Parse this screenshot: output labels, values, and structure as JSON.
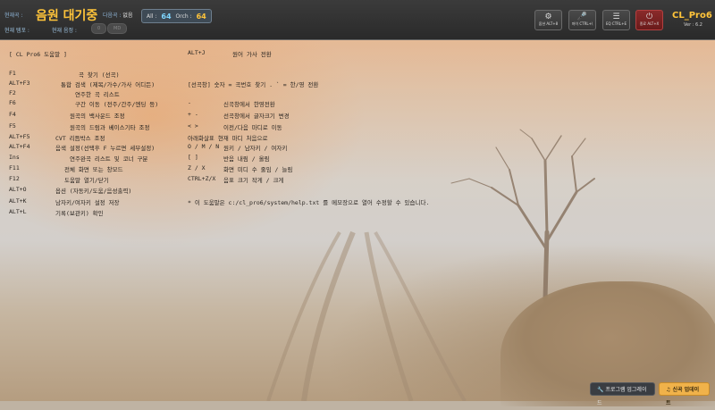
{
  "header": {
    "current_song_label": "현재곡 :",
    "current_song": "음원 대기중",
    "waiting_label": "다음곡 :",
    "waiting_value": "없음",
    "all_label": "All :",
    "all_count": "64",
    "orch_label": "Orch :",
    "orch_count": "64",
    "song_number_label": "현재 템포 :",
    "current_pitch_label": "현재 음정 :",
    "pill_1": "0",
    "pill_2": "MD",
    "buttons": [
      {
        "label": "옵션 ALT+8",
        "icon": "gear-icon"
      },
      {
        "label": "마이 CTRL+\\",
        "icon": "mic-icon"
      },
      {
        "label": "EQ CTRL+E",
        "icon": "equalizer-icon"
      },
      {
        "label": "종료 ALT+X",
        "icon": "power-icon"
      }
    ],
    "brand": "CL_Pro6",
    "version": "Ver : 6.2"
  },
  "help": {
    "title": "[ CL Pro6 도움말 ]",
    "title_right_key": "ALT+J",
    "title_right_desc": "원어 가사 전환",
    "left": [
      {
        "key": "F1",
        "desc": "곡 찾기 (선곡)"
      },
      {
        "key": "ALT+F3",
        "desc": "통합 검색 (제목/가수/가사 어디든)"
      },
      {
        "key": "F2",
        "desc": "연주한 곡 리스트"
      },
      {
        "key": "F6",
        "desc": "구간 이동 (전주/간주/엔딩 등)"
      },
      {
        "key": "F4",
        "desc": "원곡의 백사운드 조정"
      },
      {
        "key": "F5",
        "desc": "원곡의 드럼과 베이스기타 조정"
      },
      {
        "key": "ALT+F5",
        "desc": "CVT 리듬박스 조정"
      },
      {
        "key": "ALT+F4",
        "desc": "음색 설정(선택후 F 누르면 세부설정)"
      },
      {
        "key": "Ins",
        "desc": "연주완곡 리스트 및 코너 구분"
      },
      {
        "key": "F11",
        "desc": "전체 화면 또는 창모드"
      },
      {
        "key": "F12",
        "desc": "도움말 열기/닫기"
      },
      {
        "key": "ALT+O",
        "desc": "옵션 (자동키/도움/음성출력)"
      },
      {
        "key": "ALT+K",
        "desc": "남자키/여자키 설정 저장"
      },
      {
        "key": "ALT+L",
        "desc": "기록(보관키) 확인"
      }
    ],
    "right": [
      {
        "key": "[선곡창] 숫자 = 곡번호 찾기 . ` = 한/영 전환",
        "desc": ""
      },
      {
        "key": "-",
        "desc": "신곡창에서 한영전환"
      },
      {
        "key": "+ -",
        "desc": "선곡창에서 글자크기 변경"
      },
      {
        "key": "< >",
        "desc": "이전/다음 마디로 이동"
      },
      {
        "key": "아래화살표 현재 마디 처음으로",
        "desc": ""
      },
      {
        "key": "O / M / N",
        "desc": "원키 / 남자키 / 여자키"
      },
      {
        "key": "[ ]",
        "desc": "반음 내림 / 올림"
      },
      {
        "key": "Z / X",
        "desc": "화면 미디 수 줄임 / 늘림"
      },
      {
        "key": "CTRL+Z/X",
        "desc": "음표 크기 작게 / 크게"
      },
      {
        "key": "",
        "desc": ""
      },
      {
        "key": "* 이 도움말은 c:/cl_pro6/system/help.txt 를 메모장으로 열어 수정할 수 있습니다.",
        "desc": ""
      }
    ]
  },
  "footer": {
    "upgrade_button": "프로그램 업그레이드",
    "update_button": "신곡 업데이트"
  }
}
